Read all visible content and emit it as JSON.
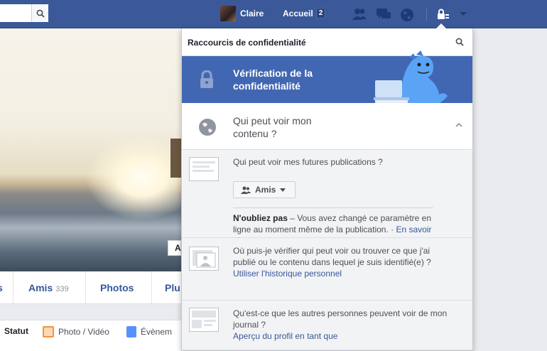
{
  "topbar": {
    "user_name": "Claire",
    "home_label": "Accueil",
    "home_count": "2",
    "icons": [
      "friends-icon",
      "messages-icon",
      "globe-icon",
      "lock-icon",
      "chevron-down-icon"
    ]
  },
  "profile": {
    "tabs": [
      {
        "label": "s"
      },
      {
        "label": "Amis",
        "count": "339"
      },
      {
        "label": "Photos"
      },
      {
        "label": "Plu"
      }
    ],
    "cover_tag": "A",
    "composer": [
      {
        "label": "Statut"
      },
      {
        "label": "Photo / Vidéo"
      },
      {
        "label": "Évènem"
      }
    ]
  },
  "panel": {
    "title": "Raccourcis de confidentialité",
    "checkup": {
      "line1": "Vérification de la",
      "line2": "confidentialité"
    },
    "who_see": {
      "line1": "Qui peut voir mon",
      "line2": "contenu ?"
    },
    "future": {
      "question": "Qui peut voir mes futures publications ?",
      "audience": "Amis",
      "note_bold": "N'oubliez pas",
      "note_text": " – Vous avez changé ce paramètre en ligne au moment même de la publication. · ",
      "note_link": "En savoir plus"
    },
    "activity": {
      "question": "Où puis-je vérifier qui peut voir ou trouver ce que j'ai publié ou le contenu dans lequel je suis identifié(e) ?",
      "link": "Utiliser l'historique personnel"
    },
    "timeline": {
      "question": "Qu'est-ce que les autres personnes peuvent voir de mon journal ?",
      "link": "Aperçu du profil en tant que"
    }
  },
  "colors": {
    "brand": "#3b5998",
    "checkup_bg": "#4267b2",
    "link": "#365899"
  }
}
